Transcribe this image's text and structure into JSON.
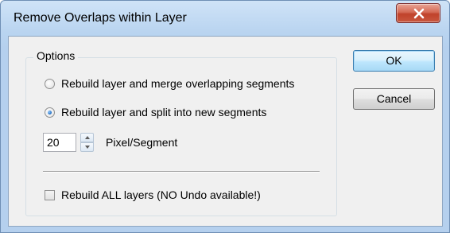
{
  "window": {
    "title": "Remove Overlaps within Layer",
    "close_icon": "close-x-icon"
  },
  "options": {
    "group_label": "Options",
    "radio_merge_label": "Rebuild layer and merge overlapping segments",
    "radio_merge_checked": false,
    "radio_split_label": "Rebuild layer and split into new segments",
    "radio_split_checked": true,
    "pixel_value": "20",
    "pixel_label": "Pixel/Segment",
    "rebuild_all_label": "Rebuild ALL layers (NO Undo available!)",
    "rebuild_all_checked": false
  },
  "buttons": {
    "ok_label": "OK",
    "cancel_label": "Cancel"
  },
  "colors": {
    "titlebar": "#b9d4f0",
    "close_button": "#c9573f",
    "default_button_border": "#3c7fb1"
  }
}
